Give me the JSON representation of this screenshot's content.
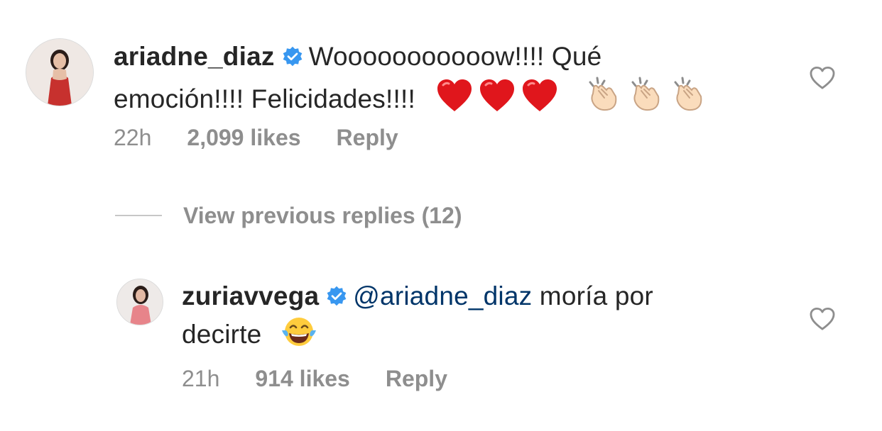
{
  "comments": [
    {
      "username": "ariadne_diaz",
      "text": "Wooooooooooow!!!! Qué emoción!!!! Felicidades!!!!",
      "text_line1": "Wooooooooooow!!!! Qué",
      "text_line2": "emoción!!!! Felicidades!!!!",
      "emojis": [
        "heart",
        "heart",
        "heart",
        "clap",
        "clap",
        "clap"
      ],
      "time": "22h",
      "likes": "2,099 likes",
      "reply": "Reply",
      "verified": true
    },
    {
      "username": "zuriavvega",
      "mention": "@ariadne_diaz",
      "text_line1": " moría por",
      "text_line2": "decirte",
      "emojis": [
        "tears-of-joy"
      ],
      "time": "21h",
      "likes": "914 likes",
      "reply": "Reply",
      "verified": true
    }
  ],
  "view_previous_replies": "View previous replies (12)",
  "colors": {
    "text": "#262626",
    "meta": "#8e8e8e",
    "mention": "#003569",
    "verified": "#3897f0",
    "heart_red": "#e0161c"
  },
  "icons": {
    "verified": "verified-badge-icon",
    "like": "heart-outline-icon"
  }
}
